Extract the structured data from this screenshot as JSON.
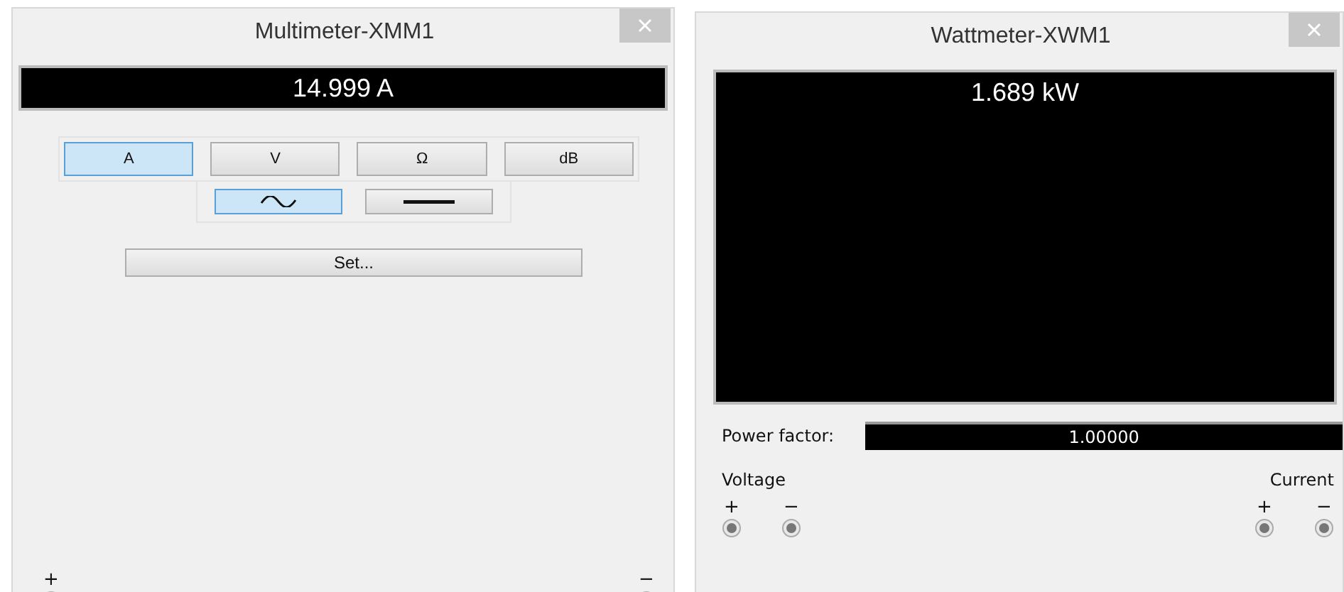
{
  "multimeter": {
    "title": "Multimeter-XMM1",
    "reading": "14.999 A",
    "modes": [
      {
        "label": "A",
        "selected": true
      },
      {
        "label": "V",
        "selected": false
      },
      {
        "label": "Ω",
        "selected": false
      },
      {
        "label": "dB",
        "selected": false
      }
    ],
    "waveforms": [
      {
        "kind": "ac",
        "selected": true
      },
      {
        "kind": "dc",
        "selected": false
      }
    ],
    "set_button": "Set...",
    "terminals": [
      {
        "label": "+"
      },
      {
        "label": "−"
      }
    ]
  },
  "wattmeter": {
    "title": "Wattmeter-XWM1",
    "reading": "1.689 kW",
    "power_factor": {
      "label": "Power factor:",
      "value": "1.00000"
    },
    "groups": [
      {
        "label": "Voltage",
        "terminals": [
          "+",
          "−"
        ]
      },
      {
        "label": "Current",
        "terminals": [
          "+",
          "−"
        ]
      }
    ]
  }
}
